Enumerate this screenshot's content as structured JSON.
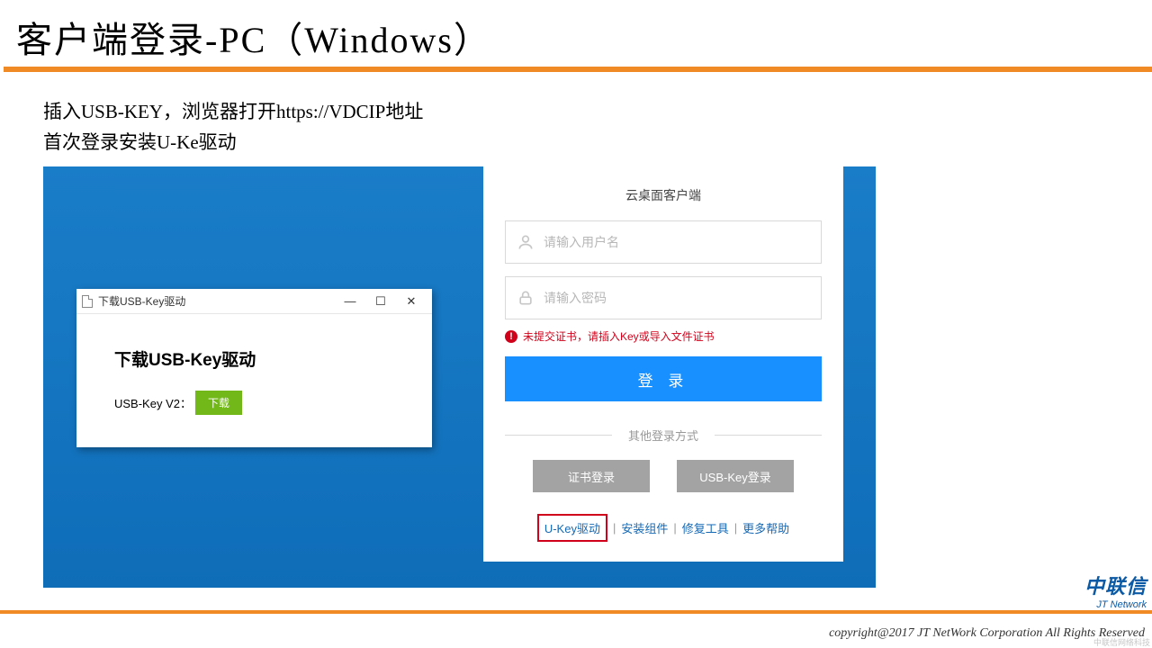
{
  "slide": {
    "title": "客户端登录-PC（Windows）",
    "sub1": "插入USB-KEY，浏览器打开https://VDCIP地址",
    "sub2": "首次登录安装U-Ke驱动"
  },
  "login": {
    "card_title": "云桌面客户端",
    "user_ph": "请输入用户名",
    "pwd_ph": "请输入密码",
    "error": "未提交证书，请插入Key或导入文件证书",
    "login_btn": "登 录",
    "divider": "其他登录方式",
    "alt_cert": "证书登录",
    "alt_usb": "USB-Key登录",
    "link_ukey": "U-Key驱动",
    "link_install": "安装组件",
    "link_repair": "修复工具",
    "link_more": "更多帮助"
  },
  "dialog": {
    "titlebar": "下载USB-Key驱动",
    "heading": "下载USB-Key驱动",
    "version_label": "USB-Key V2：",
    "download": "下载"
  },
  "footer": {
    "logo_cn": "中联信",
    "logo_en": "JT Network",
    "copyright": "copyright@2017  JT NetWork Corporation All Rights Reserved",
    "watermark": "中联信网络科技"
  }
}
